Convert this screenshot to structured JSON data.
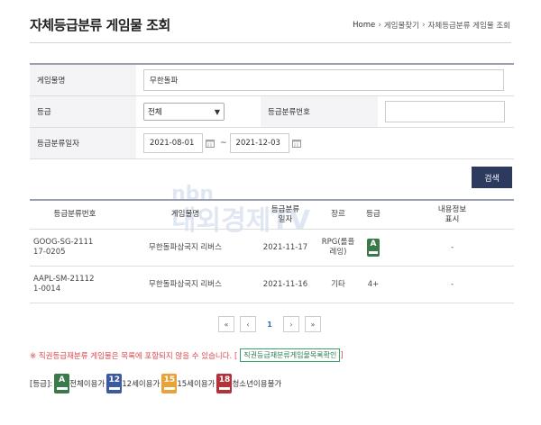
{
  "page": {
    "title": "자체등급분류 게임물 조회"
  },
  "breadcrumb": {
    "home": "Home",
    "items": [
      "게임물찾기",
      "자체등급분류 게임물 조회"
    ]
  },
  "form": {
    "game_name_label": "게임물명",
    "game_name_value": "무한돌파",
    "grade_label": "등급",
    "grade_selected": "전체",
    "class_no_label": "등급분류번호",
    "class_no_value": "",
    "date_label": "등급분류일자",
    "date_from": "2021-08-01",
    "date_tilde": "~",
    "date_to": "2021-12-03",
    "search_label": "검색"
  },
  "table": {
    "headers": [
      "등급분류번호",
      "게임물명",
      "등급분류\n일자",
      "장르",
      "등급",
      "내용정보\n표시"
    ],
    "rows": [
      {
        "number": "GOOG-SG-2111\n17-0205",
        "name": "무한돌파삼국지 리버스",
        "date": "2021-11-17",
        "genre": "RPG(롤플\n레잉)",
        "grade": "",
        "grade_icon": "all-ages-rating-icon",
        "content_info": "-"
      },
      {
        "number": "AAPL-SM-21112\n1-0014",
        "name": "무한돌파삼국지 리버스",
        "date": "2021-11-16",
        "genre": "기타",
        "grade": "4+",
        "grade_icon": "",
        "content_info": "-"
      }
    ]
  },
  "pagination": {
    "first": "«",
    "prev": "‹",
    "current": "1",
    "next": "›",
    "last": "»"
  },
  "notice": {
    "text": "※ 직권등급재분류 게임물은 목록에 포함되지 않을 수 있습니다. [",
    "link": "직권등급재분류게임물목록확인",
    "close": "]"
  },
  "legend": {
    "prefix": "[등급]:",
    "items": [
      {
        "label": "전체이용가",
        "glyph": "ALL",
        "color": "#3a7a4a"
      },
      {
        "label": "12세이용가",
        "glyph": "12",
        "color": "#3b5aa0"
      },
      {
        "label": "15세이용가",
        "glyph": "15",
        "color": "#e8a237"
      },
      {
        "label": "청소년이용불가",
        "glyph": "18",
        "color": "#b3323a"
      }
    ]
  },
  "colors": {
    "search_button": "#2c3a60",
    "notice": "#e0454f",
    "link_border": "#3aa36b"
  },
  "watermark": {
    "text": "nbn 내외경제TV"
  }
}
